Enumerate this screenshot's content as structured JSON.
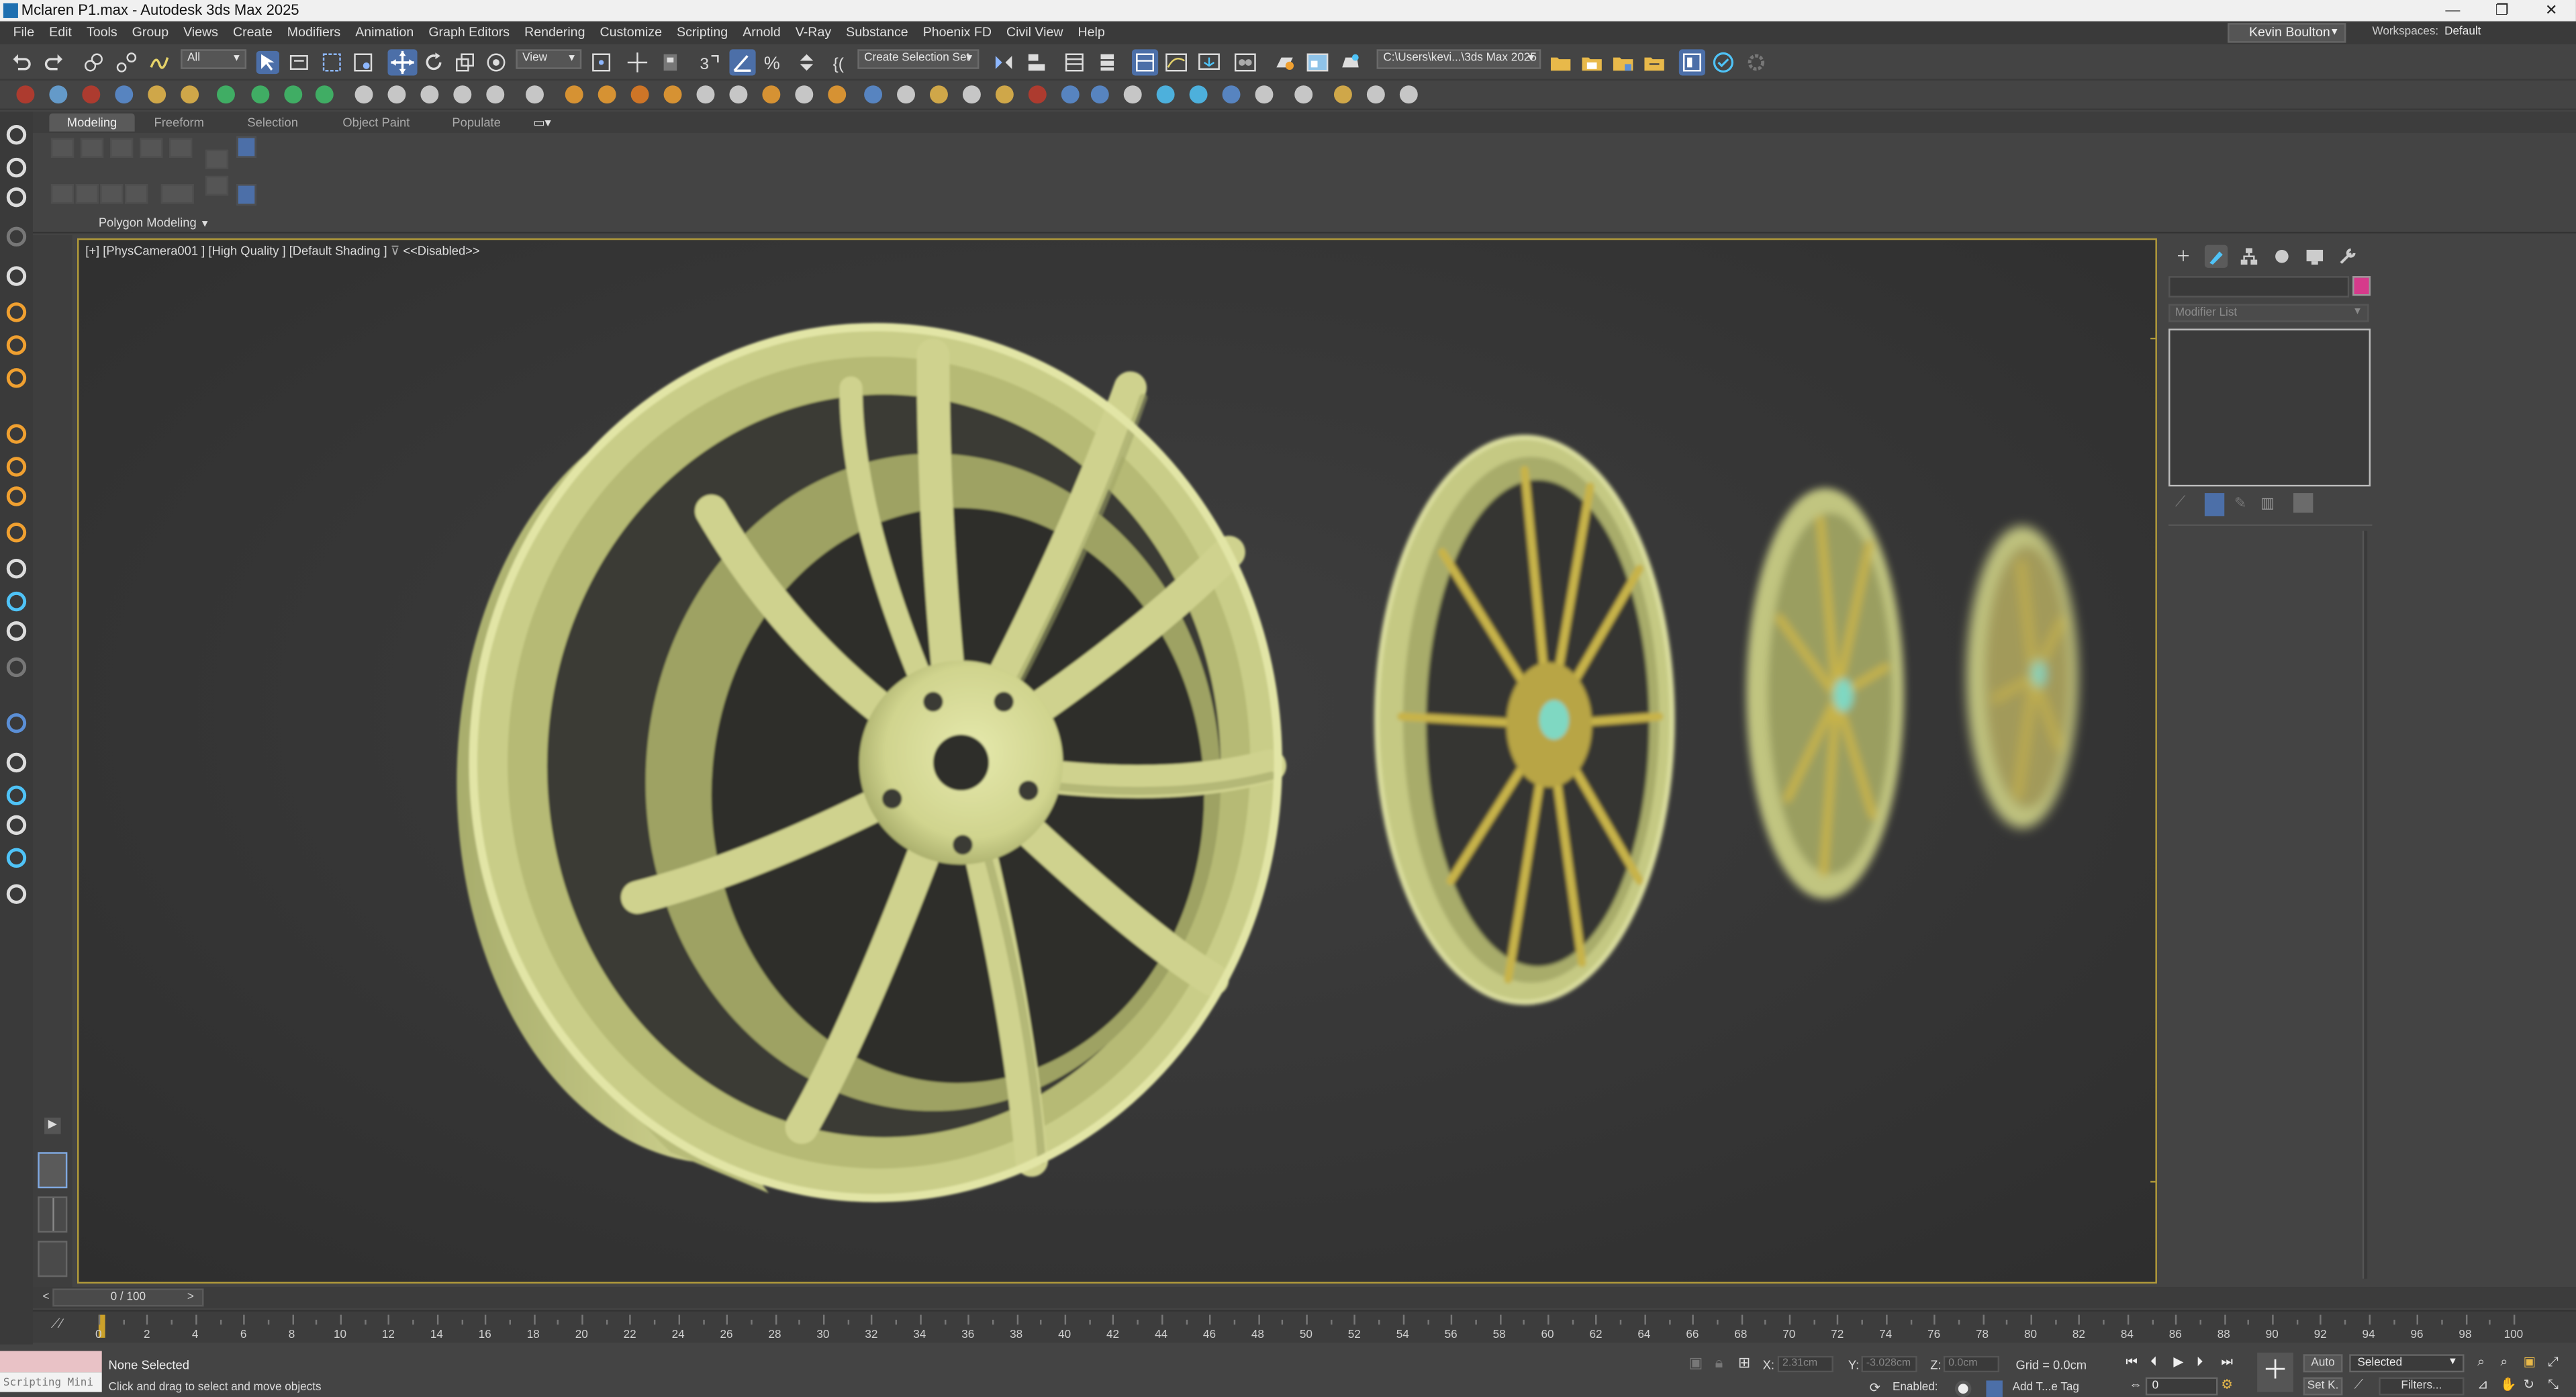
{
  "window": {
    "title": "Mclaren P1.max - Autodesk 3ds Max 2025",
    "controls": [
      "—",
      "❐",
      "✕"
    ]
  },
  "menu": [
    "File",
    "Edit",
    "Tools",
    "Group",
    "Views",
    "Create",
    "Modifiers",
    "Animation",
    "Graph Editors",
    "Rendering",
    "Customize",
    "Scripting",
    "Arnold",
    "V-Ray",
    "Substance",
    "Phoenix FD",
    "Civil View",
    "Help"
  ],
  "user": {
    "name": "Kevin Boulton"
  },
  "workspace": {
    "label": "Workspaces:",
    "value": "Default"
  },
  "toolbar": {
    "selection_filter": "All",
    "reference_coord": "View",
    "named_selection": "Create Selection Set",
    "project_path": "C:\\Users\\kevi...\\3ds Max 2025"
  },
  "ribbon": {
    "tabs": [
      "Modeling",
      "Freeform",
      "Selection",
      "Object Paint",
      "Populate"
    ],
    "active_tab": "Modeling",
    "panel_label": "Polygon Modeling"
  },
  "viewport": {
    "label": "[+] [PhysCamera001 ] [High Quality ] [Default Shading ]",
    "filter": "<<Disabled>>",
    "colors": {
      "rim_light": "#e4e7a8",
      "rim_mid": "#c9cd88",
      "rim_dark": "#8f9457",
      "spoke_gold": "#c7b34a",
      "hub_teal": "#7fd8c2"
    }
  },
  "command_panel": {
    "tabs": [
      "create-icon",
      "modify-icon",
      "hierarchy-icon",
      "motion-icon",
      "display-icon",
      "utilities-icon"
    ],
    "active_tab": "modify-icon",
    "modifier_list": "Modifier List",
    "swatch_color": "#d63a8b"
  },
  "timeline": {
    "frame_display": "0 / 100",
    "ticks": [
      "0",
      "2",
      "4",
      "6",
      "8",
      "10",
      "12",
      "14",
      "16",
      "18",
      "20",
      "22",
      "24",
      "26",
      "28",
      "30",
      "32",
      "34",
      "36",
      "38",
      "40",
      "42",
      "44",
      "46",
      "48",
      "50",
      "52",
      "54",
      "56",
      "58",
      "60",
      "62",
      "64",
      "66",
      "68",
      "70",
      "72",
      "74",
      "76",
      "78",
      "80",
      "82",
      "84",
      "86",
      "88",
      "90",
      "92",
      "94",
      "96",
      "98",
      "100"
    ]
  },
  "status": {
    "script_listener": "Scripting Mini",
    "selection": "None Selected",
    "hint": "Click and drag to select and move objects",
    "x_label": "X:",
    "x_value": "2.31cm",
    "y_label": "Y:",
    "y_value": "-3.028cm",
    "z_label": "Z:",
    "z_value": "0.0cm",
    "grid": "Grid = 0.0cm",
    "enabled": "Enabled:",
    "add_tag": "Add T...e Tag",
    "auto_key": "Auto",
    "set_key": "Set K.",
    "key_filter": "Selected",
    "filters": "Filters...",
    "current_frame": "0"
  }
}
